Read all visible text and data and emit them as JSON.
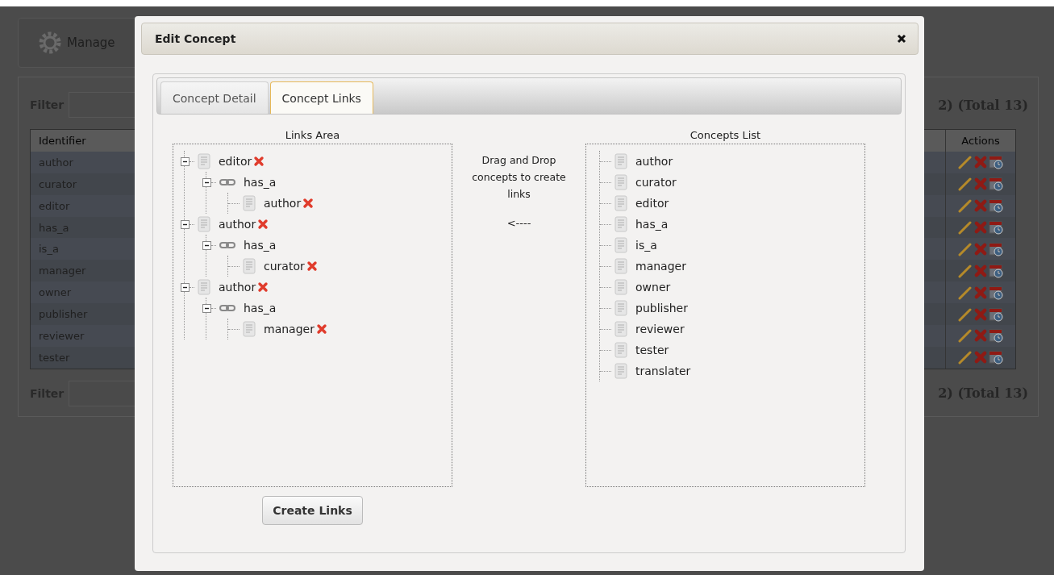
{
  "background": {
    "manage_button": "Manage",
    "filters": [
      {
        "label": "Filter",
        "summary": "2) (Total 13)"
      },
      {
        "label": "Filter",
        "summary": "2) (Total 13)"
      }
    ],
    "table": {
      "columns": [
        "Identifier",
        "Actions"
      ],
      "rows": [
        "author",
        "curator",
        "editor",
        "has_a",
        "is_a",
        "manager",
        "owner",
        "publisher",
        "reviewer",
        "tester"
      ]
    }
  },
  "dialog": {
    "title": "Edit Concept",
    "tabs": [
      {
        "label": "Concept Detail",
        "selected": false
      },
      {
        "label": "Concept Links",
        "selected": true
      }
    ],
    "links_area": {
      "title": "Links Area",
      "tree": [
        {
          "label": "editor",
          "kind": "concept",
          "removable": true,
          "expanded": true,
          "children": [
            {
              "label": "has_a",
              "kind": "relation",
              "removable": false,
              "expanded": true,
              "children": [
                {
                  "label": "author",
                  "kind": "concept",
                  "removable": true
                }
              ]
            }
          ]
        },
        {
          "label": "author",
          "kind": "concept",
          "removable": true,
          "expanded": true,
          "children": [
            {
              "label": "has_a",
              "kind": "relation",
              "removable": false,
              "expanded": true,
              "children": [
                {
                  "label": "curator",
                  "kind": "concept",
                  "removable": true
                }
              ]
            }
          ]
        },
        {
          "label": "author",
          "kind": "concept",
          "removable": true,
          "expanded": true,
          "children": [
            {
              "label": "has_a",
              "kind": "relation",
              "removable": false,
              "expanded": true,
              "children": [
                {
                  "label": "manager",
                  "kind": "concept",
                  "removable": true
                }
              ]
            }
          ]
        }
      ]
    },
    "hint": "Drag and Drop concepts to create links",
    "arrow": "<----",
    "concepts_list": {
      "title": "Concepts List",
      "items": [
        "author",
        "curator",
        "editor",
        "has_a",
        "is_a",
        "manager",
        "owner",
        "publisher",
        "reviewer",
        "tester",
        "translater"
      ]
    },
    "button": "Create Links"
  }
}
